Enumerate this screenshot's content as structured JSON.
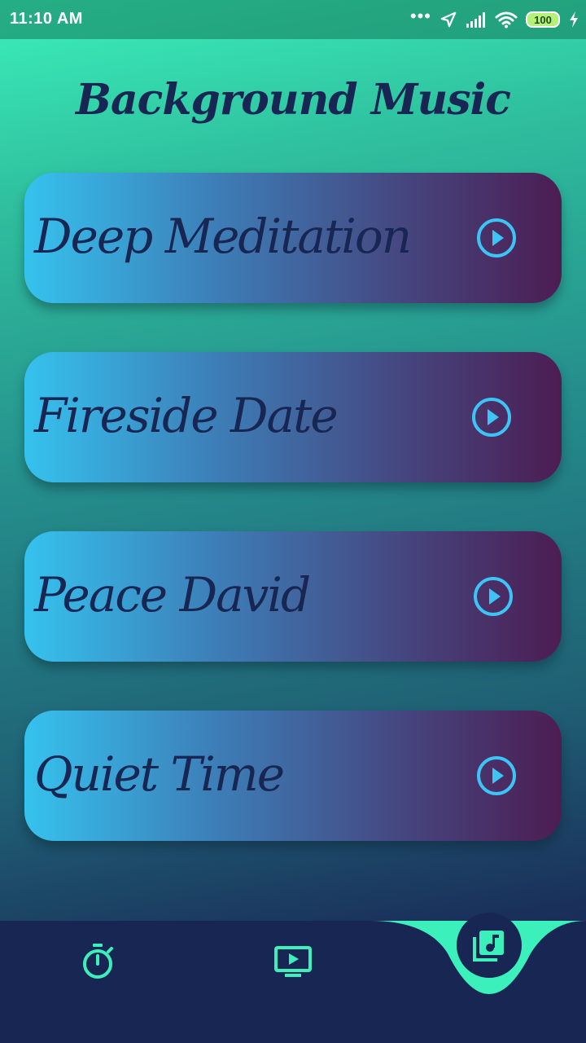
{
  "status_bar": {
    "time": "11:10 AM",
    "battery": "100",
    "icons": [
      "more-dots-icon",
      "location-arrow-icon",
      "signal-bars-icon",
      "wifi-icon",
      "battery-icon",
      "charging-bolt-icon"
    ]
  },
  "title": "Background Music",
  "tracks": [
    {
      "title": "Deep Meditation",
      "icon": "play-circle-icon"
    },
    {
      "title": "Fireside Date",
      "icon": "play-circle-icon"
    },
    {
      "title": "Peace David",
      "icon": "play-circle-icon"
    },
    {
      "title": "Quiet Time",
      "icon": "play-circle-icon"
    }
  ],
  "bottom_nav": {
    "items": [
      {
        "icon": "stopwatch-icon"
      },
      {
        "icon": "video-play-icon"
      },
      {
        "icon": "music-library-icon",
        "selected": true
      }
    ]
  },
  "colors": {
    "accent": "#3bf0bb",
    "navy": "#172653",
    "play_icon": "#3cc4f4",
    "card_start": "#36c2ee",
    "card_end": "#4c1d53"
  }
}
